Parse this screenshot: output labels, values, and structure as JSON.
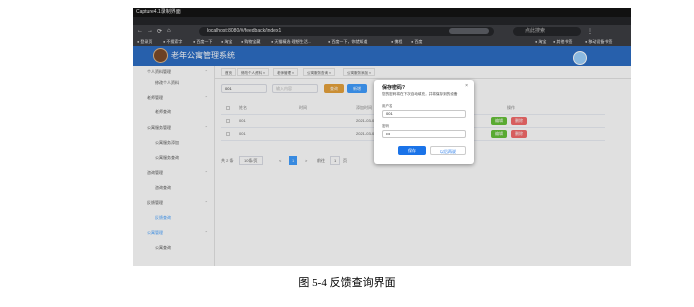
{
  "window_caption": "Capture4.1录制界面",
  "browser": {
    "url": "localhost:8080/#/feedback/index1",
    "search_placeholder": "点此搜索",
    "bookmarks": [
      "登录页",
      "不搜索字",
      "百度一下",
      "淘宝",
      "购物宝藏",
      "天猫精选·理想生活...",
      "百度一下，你就知道",
      "携程",
      "百度",
      "淘宝",
      "其他书签",
      "移动设备书签"
    ]
  },
  "app": {
    "title": "老年公寓管理系统"
  },
  "sidebar": {
    "items": [
      {
        "label": "个人资料管理",
        "type": "group"
      },
      {
        "label": "修改个人资料",
        "type": "sub"
      },
      {
        "label": "老师管理",
        "type": "group"
      },
      {
        "label": "老师查询",
        "type": "sub"
      },
      {
        "label": "公寓服务管理",
        "type": "group"
      },
      {
        "label": "公寓服务添加",
        "type": "sub"
      },
      {
        "label": "公寓服务查询",
        "type": "sub"
      },
      {
        "label": "咨询管理",
        "type": "group"
      },
      {
        "label": "咨询查询",
        "type": "sub"
      },
      {
        "label": "反馈管理",
        "type": "group"
      },
      {
        "label": "反馈查询",
        "type": "sub"
      },
      {
        "label": "公寓管理",
        "type": "group"
      },
      {
        "label": "公寓查询",
        "type": "sub"
      }
    ]
  },
  "tabs": [
    "首页",
    "修改个人资料 ×",
    "老师管理 ×",
    "公寓服务查询 ×",
    "公寓服务添加 ×"
  ],
  "filter": {
    "input1_value": "001",
    "input2_placeholder": "输入内容",
    "search_label": "查询",
    "add_label": "新增"
  },
  "table": {
    "headers": [
      "",
      "姓名",
      "时间",
      "添加时间",
      "",
      "操作"
    ],
    "rows": [
      {
        "name": "001",
        "time": "",
        "added": "2021-03-06 02:34:17",
        "edit": "编辑",
        "delete": "删除"
      },
      {
        "name": "001",
        "time": "",
        "added": "2021-03-06 02:29:02",
        "edit": "编辑",
        "delete": "删除"
      }
    ]
  },
  "pager": {
    "total": "共 2 条",
    "page_size": "10条/页",
    "prev": "<",
    "current": "1",
    "next": ">",
    "goto_label": "前往",
    "goto_value": "1",
    "page_suffix": "页"
  },
  "password_dialog": {
    "title": "保存密码?",
    "close": "×",
    "desc": "您的密码将在下次自动填充，并将保存到的设备",
    "username_label": "用户名",
    "username_value": "001",
    "password_label": "密码",
    "password_value": "•••",
    "save_label": "保存",
    "never_label": "以后再说"
  },
  "figure_caption": "图 5-4 反馈查询界面",
  "colors": {
    "banner": "#2d6ec4",
    "primary": "#409eff",
    "search_button": "#e6a23c",
    "edit_button": "#67c23a",
    "delete_button": "#f56c6c"
  }
}
